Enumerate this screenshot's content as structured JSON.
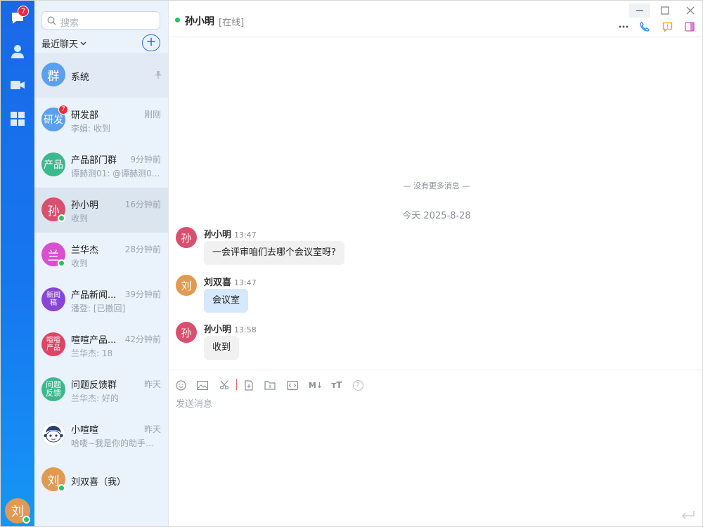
{
  "rail": {
    "chat_badge": "7",
    "me_avatar": "刘",
    "colors": {
      "rail_top": "#1a68e8",
      "rail_bottom": "#1597f5"
    }
  },
  "sessions": {
    "search_placeholder": "搜索",
    "section_label": "最近聊天",
    "add_label": "+",
    "items": [
      {
        "avatar": "群",
        "name": "系统",
        "time": "",
        "preview": "",
        "color": "#5ba0ef"
      },
      {
        "avatar": "研发",
        "name": "研发部",
        "time": "刚刚",
        "preview": "李娟: 收到",
        "badge": "7",
        "color": "#5ba0ef"
      },
      {
        "avatar": "产品",
        "name": "产品部门群",
        "time": "9分钟前",
        "preview": "谭赫测01: @谭赫测0...",
        "color": "#3cb88f"
      },
      {
        "avatar": "孙",
        "name": "孙小明",
        "time": "16分钟前",
        "preview": "收到",
        "color": "#d8506e"
      },
      {
        "avatar": "兰",
        "name": "兰华杰",
        "time": "28分钟前",
        "preview": "收到",
        "color": "#d84fd0"
      },
      {
        "avatar": "新闻稿",
        "name": "产品新闻...",
        "time": "39分钟前",
        "preview": "潘登: [已撤回]",
        "color": "#8a45d6"
      },
      {
        "avatar": "喧喧产品",
        "name": "喧喧产品...",
        "time": "42分钟前",
        "preview": "兰华杰: 18",
        "color": "#dd4466"
      },
      {
        "avatar": "问题反馈",
        "name": "问题反馈群",
        "time": "昨天",
        "preview": "兰华杰: 好的",
        "color": "#3cb88f"
      },
      {
        "avatar": "",
        "name": "小喧喧",
        "time": "昨天",
        "preview": "哈喽~我是你的助手小...",
        "color": "#ffffff"
      },
      {
        "avatar": "刘",
        "name": "刘双喜（我）",
        "time": "",
        "preview": "",
        "color": "#e09a52"
      }
    ]
  },
  "chat": {
    "title": "孙小明",
    "status": "[在线]",
    "no_more": "— 没有更多消息 —",
    "date": "今天 2025-8-28",
    "messages": [
      {
        "avatar": "孙",
        "sender": "孙小明",
        "time": "13:47",
        "text": "一会评审咱们去哪个会议室呀?",
        "color": "#d8506e",
        "mine": false
      },
      {
        "avatar": "刘",
        "sender": "刘双喜",
        "time": "13:47",
        "text": "会议室",
        "color": "#e09a52",
        "mine": true
      },
      {
        "avatar": "孙",
        "sender": "孙小明",
        "time": "13:58",
        "text": "收到",
        "color": "#d8506e",
        "mine": false
      }
    ],
    "composer_placeholder": "发送消息",
    "toolbar": [
      "emoji-icon",
      "image-icon",
      "scissors-icon",
      "file-icon",
      "folder-icon",
      "code-icon",
      "markdown-icon",
      "text-format-icon",
      "help-icon"
    ],
    "markdown_label": "M↓",
    "text_format_label": "ᴛT",
    "help_label": "?"
  }
}
